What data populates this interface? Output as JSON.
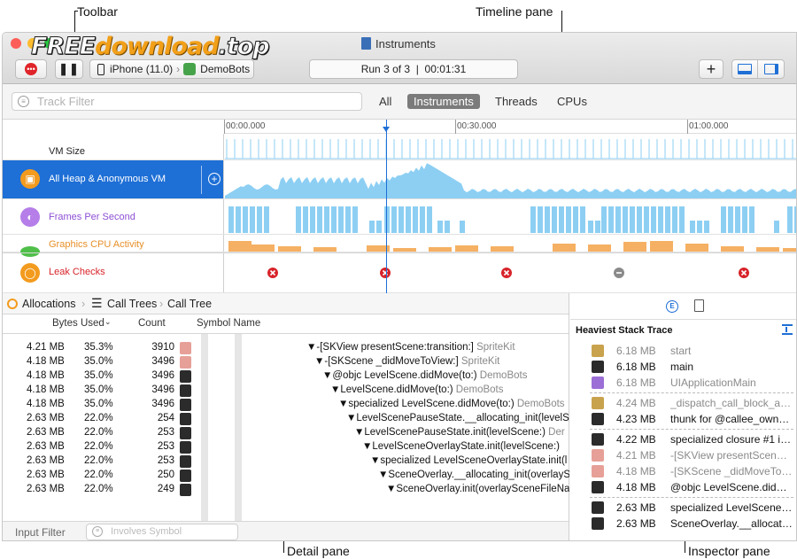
{
  "annotations": {
    "toolbar": "Toolbar",
    "timeline_pane": "Timeline pane",
    "detail_pane": "Detail pane",
    "inspector_pane": "Inspector pane"
  },
  "watermark": {
    "part1": "FREE",
    "part2": "download",
    "part3": ".top"
  },
  "window": {
    "title": "Instruments",
    "device": "iPhone (11.0)",
    "target": "DemoBots",
    "run_status": "Run 3 of 3  |  00:01:31",
    "add_label": "+"
  },
  "filter": {
    "placeholder": "Track Filter",
    "segments": [
      "All",
      "Instruments",
      "Threads",
      "CPUs"
    ],
    "selected": "Instruments"
  },
  "ruler": [
    "00:00.000",
    "00:30.000",
    "01:00.000"
  ],
  "tracks": [
    {
      "label": "VM Size"
    },
    {
      "label": "All Heap & Anonymous VM"
    },
    {
      "label": "Frames Per Second"
    },
    {
      "label": "Graphics CPU Activity"
    },
    {
      "label": "Leak Checks"
    }
  ],
  "breadcrumb": [
    "Allocations",
    "Call Trees",
    "Call Tree"
  ],
  "columns": {
    "bytes": "Bytes Used",
    "count": "Count",
    "symbol": "Symbol Name"
  },
  "rows": [
    {
      "bytes": "4.21 MB",
      "pct": "35.3%",
      "count": "3910",
      "symbol": "▼-[SKView presentScene:transition:]",
      "lib": "SpriteKit",
      "indent": 0,
      "kind": "lib"
    },
    {
      "bytes": "4.18 MB",
      "pct": "35.0%",
      "count": "3496",
      "symbol": "▼-[SKScene _didMoveToView:]",
      "lib": "SpriteKit",
      "indent": 1,
      "kind": "lib"
    },
    {
      "bytes": "4.18 MB",
      "pct": "35.0%",
      "count": "3496",
      "symbol": "▼@objc LevelScene.didMove(to:)",
      "lib": "DemoBots",
      "indent": 2,
      "kind": "user"
    },
    {
      "bytes": "4.18 MB",
      "pct": "35.0%",
      "count": "3496",
      "symbol": "▼LevelScene.didMove(to:)",
      "lib": "DemoBots",
      "indent": 3,
      "kind": "user"
    },
    {
      "bytes": "4.18 MB",
      "pct": "35.0%",
      "count": "3496",
      "symbol": "▼specialized LevelScene.didMove(to:)",
      "lib": "DemoBots",
      "indent": 4,
      "kind": "user"
    },
    {
      "bytes": "2.63 MB",
      "pct": "22.0%",
      "count": "254",
      "symbol": "▼LevelScenePauseState.__allocating_init(levelS",
      "lib": "",
      "indent": 5,
      "kind": "user"
    },
    {
      "bytes": "2.63 MB",
      "pct": "22.0%",
      "count": "253",
      "symbol": "▼LevelScenePauseState.init(levelScene:)",
      "lib": "Der",
      "indent": 6,
      "kind": "user"
    },
    {
      "bytes": "2.63 MB",
      "pct": "22.0%",
      "count": "253",
      "symbol": "▼LevelSceneOverlayState.init(levelScene:)",
      "lib": "",
      "indent": 7,
      "kind": "user"
    },
    {
      "bytes": "2.63 MB",
      "pct": "22.0%",
      "count": "253",
      "symbol": "▼specialized LevelSceneOverlayState.init(l",
      "lib": "",
      "indent": 8,
      "kind": "user"
    },
    {
      "bytes": "2.63 MB",
      "pct": "22.0%",
      "count": "250",
      "symbol": "▼SceneOverlay.__allocating_init(overlayS",
      "lib": "",
      "indent": 9,
      "kind": "user"
    },
    {
      "bytes": "2.63 MB",
      "pct": "22.0%",
      "count": "249",
      "symbol": "▼SceneOverlay.init(overlaySceneFileNa",
      "lib": "",
      "indent": 10,
      "kind": "user"
    }
  ],
  "footer": {
    "input_filter": "Input Filter",
    "involves_placeholder": "Involves Symbol"
  },
  "inspector": {
    "title": "Heaviest Stack Trace",
    "items": [
      {
        "size": "6.18 MB",
        "name": "start",
        "kind": "sys",
        "dim": true
      },
      {
        "size": "6.18 MB",
        "name": "main",
        "kind": "user",
        "dim": false
      },
      {
        "size": "6.18 MB",
        "name": "UIApplicationMain",
        "kind": "ui",
        "dim": true
      },
      {
        "size": "4.24 MB",
        "name": "_dispatch_call_block_a…",
        "kind": "sys",
        "dim": true
      },
      {
        "size": "4.23 MB",
        "name": "thunk for @callee_own…",
        "kind": "user",
        "dim": false
      },
      {
        "size": "4.22 MB",
        "name": "specialized closure #1 i…",
        "kind": "user",
        "dim": false
      },
      {
        "size": "4.21 MB",
        "name": "-[SKView presentScen…",
        "kind": "lib",
        "dim": true
      },
      {
        "size": "4.18 MB",
        "name": "-[SKScene _didMoveTo…",
        "kind": "lib",
        "dim": true
      },
      {
        "size": "4.18 MB",
        "name": "@objc LevelScene.did…",
        "kind": "user",
        "dim": false
      },
      {
        "size": "2.63 MB",
        "name": "specialized LevelScene…",
        "kind": "user",
        "dim": false
      },
      {
        "size": "2.63 MB",
        "name": "SceneOverlay.__allocati…",
        "kind": "user",
        "dim": false
      }
    ]
  },
  "colors": {
    "accent": "#1e6fd6",
    "record": "#e0252a",
    "leak": "#d8232a",
    "heap": "#8dcff3",
    "fps": "#8dcff3",
    "gpu": "#f5b063"
  }
}
